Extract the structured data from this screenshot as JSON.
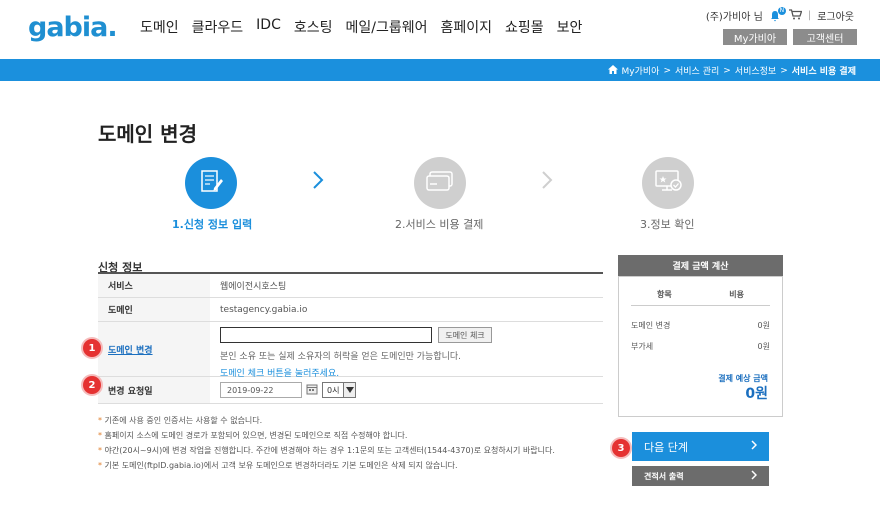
{
  "header": {
    "logo": "gabia",
    "logo_dot": ".",
    "nav": [
      "도메인",
      "클라우드",
      "IDC",
      "호스팅",
      "메일/그룹웨어",
      "홈페이지",
      "쇼핑몰",
      "보안"
    ],
    "user_name": "(주)가비아 님",
    "notif_count": "N",
    "logout": "로그아웃",
    "my_gabia": "My가비아",
    "customer_center": "고객센터"
  },
  "breadcrumb": [
    "My가비아",
    "서비스 관리",
    "서비스정보",
    "서비스 비용 결제"
  ],
  "page_title": "도메인 변경",
  "steps": [
    {
      "label": "1.신청 정보 입력",
      "active": true
    },
    {
      "label": "2.서비스 비용 결제",
      "active": false
    },
    {
      "label": "3.정보 확인",
      "active": false
    }
  ],
  "form": {
    "section_title": "신청 정보",
    "service_label": "서비스",
    "service_value": "웹에이전시호스팅",
    "domain_label": "도메인",
    "domain_value": "testagency.gabia.io",
    "change_label": "도메인 변경",
    "change_input_value": "",
    "check_button": "도메인 체크",
    "change_help": "본인 소유 또는 실제 소유자의 허락을 얻은 도메인만 가능합니다.",
    "change_link": "도메인 체크 버튼을 눌러주세요.",
    "date_label": "변경 요청일",
    "date_value": "2019-09-22",
    "hour_value": "0시",
    "badges": [
      "1",
      "2",
      "3"
    ]
  },
  "notes": [
    "기존에 사용 중인 인증서는 사용할 수 없습니다.",
    "홈페이지 소스에 도메인 경로가 포함되어 있으면, 변경된 도메인으로 직접 수정해야 합니다.",
    "야간(20시~9시)에 변경 작업을 진행합니다. 주간에 변경해야 하는 경우 1:1문의 또는 고객센터(1544-4370)로 요청하시기 바랍니다.",
    "기본 도메인(ftpID.gabia.io)에서 고객 보유 도메인으로 변경하더라도 기본 도메인은 삭제 되지 않습니다."
  ],
  "payment": {
    "title": "결제 금액 계산",
    "col_item": "항목",
    "col_cost": "비용",
    "rows": [
      {
        "item": "도메인 변경",
        "cost": "0원"
      },
      {
        "item": "부가세",
        "cost": "0원"
      }
    ],
    "total_label": "결제 예상 금액",
    "total_value": "0원",
    "next_button": "다음 단계",
    "quote_button": "견적서 출력"
  },
  "colors": {
    "brand": "#1b90dd",
    "badge": "#e53232",
    "gray": "#6c6c6c"
  }
}
